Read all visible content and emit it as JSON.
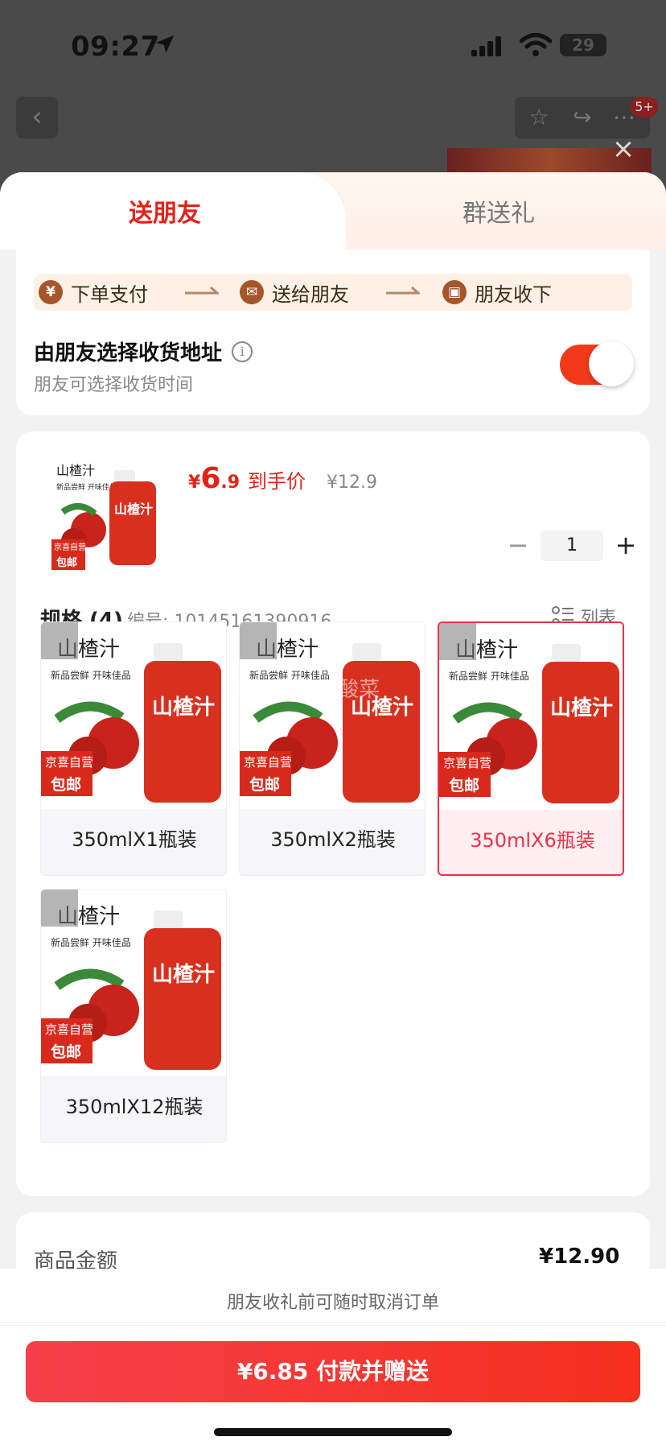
{
  "status": {
    "time": "09:27",
    "battery": "29"
  },
  "background": {
    "badge": "5+"
  },
  "tabs": {
    "active": "送朋友",
    "inactive": "群送礼"
  },
  "steps": [
    {
      "icon": "¥",
      "label": "下单支付"
    },
    {
      "icon": "✉",
      "label": "送给朋友"
    },
    {
      "icon": "▣",
      "label": "朋友收下"
    }
  ],
  "address": {
    "title": "由朋友选择收货地址",
    "subtitle": "朋友可选择收货时间",
    "toggle_on": true
  },
  "product": {
    "image_title": "山楂汁",
    "image_sub": "新品尝鲜  开味佳品",
    "image_badge_top": "京喜自营",
    "image_badge_bottom": "包邮",
    "bottle_label": "山楂汁",
    "price_symbol": "¥",
    "price_int": "6",
    "price_dec": ".9",
    "price_tag": "到手价",
    "original_price": "¥12.9",
    "quantity": "1"
  },
  "spec": {
    "title": "规格 (4)",
    "code": "编号: 10145161390916",
    "list_label": "列表",
    "items": [
      {
        "label": "350mlX1瓶装",
        "selected": false
      },
      {
        "label": "350mlX2瓶装",
        "selected": false
      },
      {
        "label": "350mlX6瓶装",
        "selected": true
      },
      {
        "label": "350mlX12瓶装",
        "selected": false
      }
    ]
  },
  "watermark": "脚本 搭老孩酸菜",
  "summary": {
    "label": "商品金额",
    "value": "¥12.90"
  },
  "footer": {
    "note": "朋友收礼前可随时取消订单",
    "pay_button": "¥6.85 付款并赠送"
  },
  "colors": {
    "accent": "#e2231a",
    "brown": "#a5562a",
    "selected_border": "#e8334a"
  }
}
